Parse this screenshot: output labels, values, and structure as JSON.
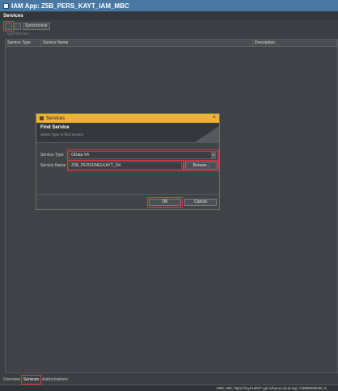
{
  "window": {
    "title": "IAM App: Z5B_PERS_KAYT_IAM_MBC"
  },
  "section": {
    "title": "Services"
  },
  "toolbar": {
    "synchronize_label": "Synchronize"
  },
  "filter": {
    "placeholder": "type filter text"
  },
  "table": {
    "columns": [
      "Service Type",
      "Service Name",
      "Description"
    ],
    "rows": []
  },
  "dialog": {
    "title": "Services",
    "heading": "Find Service",
    "subheading": "Select Type to find Service",
    "service_type_label": "Service Type",
    "service_type_value": "OData V4",
    "service_name_label": "Service Name",
    "service_name_value": "Z5B_PERSONELKAYT_O4",
    "browse_label": "Browse...",
    "ok_label": "OK",
    "cancel_label": "Cancel"
  },
  "bottom_tabs": [
    "Overview",
    "Services",
    "Authorizations"
  ],
  "status": {
    "text": "M05, 080, https://my418847-api.s4hana.cloud.sap, C8998000058, E"
  },
  "colors": {
    "title_bar": "#4a78a3",
    "dialog_title": "#f0b32f",
    "highlight": "#e53935"
  }
}
